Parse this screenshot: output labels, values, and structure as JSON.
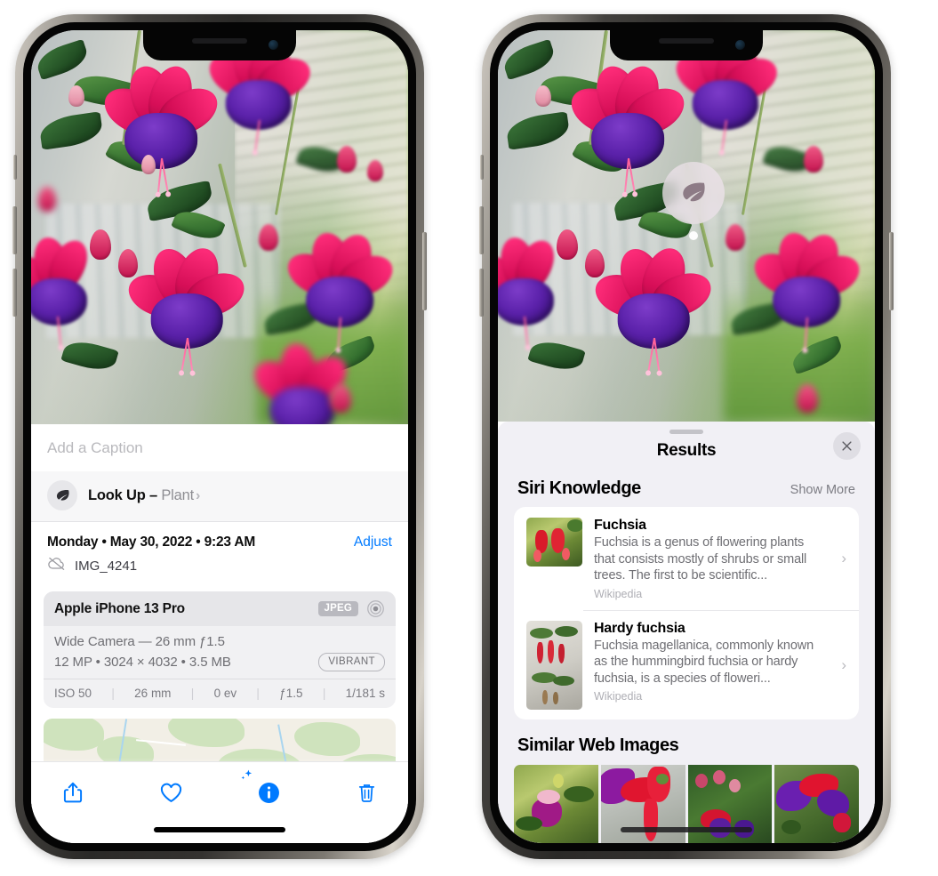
{
  "left_phone": {
    "name": "Photos app — photo info view",
    "photo_alt": "Fuchsia flowers with pink sepals and purple corollas",
    "caption_placeholder": "Add a Caption",
    "lookup": {
      "label": "Look Up –",
      "subject": "Plant",
      "chevron": "›",
      "icon": "leaf-icon",
      "sparkle_icon": "sparkle-icon"
    },
    "meta": {
      "date": "Monday • May 30, 2022 • 9:23 AM",
      "adjust_label": "Adjust",
      "cloud_icon": "cloud-slash-icon",
      "filename": "IMG_4241"
    },
    "exif": {
      "model": "Apple iPhone 13 Pro",
      "format_badge": "JPEG",
      "aperture_icon": "aperture-icon",
      "lens_line": "Wide Camera — 26 mm ƒ1.5",
      "size_line": "12 MP • 3024 × 4032 • 3.5 MB",
      "style_badge": "VIBRANT",
      "stats": [
        "ISO 50",
        "26 mm",
        "0 ev",
        "ƒ1.5",
        "1/181 s"
      ]
    },
    "map": {
      "pin_label": "photo-thumbnail-pin"
    },
    "toolbar": [
      {
        "name": "share-button",
        "icon": "share-icon"
      },
      {
        "name": "favorite-button",
        "icon": "heart-icon"
      },
      {
        "name": "info-button",
        "icon": "info-circle-icon"
      },
      {
        "name": "delete-button",
        "icon": "trash-icon"
      }
    ],
    "accent_color": "#007AFF"
  },
  "right_phone": {
    "name": "Visual Look Up results sheet",
    "photo_badge": {
      "icon": "leaf-icon",
      "name": "visual-lookup-badge"
    },
    "sheet": {
      "title": "Results",
      "close_icon": "close-icon",
      "grabber": "drag-handle"
    },
    "siri_knowledge": {
      "section_title": "Siri Knowledge",
      "show_more": "Show More",
      "items": [
        {
          "title": "Fuchsia",
          "description": "Fuchsia is a genus of flowering plants that consists mostly of shrubs or small trees. The first to be scientific...",
          "source": "Wikipedia",
          "chevron": "›",
          "thumb": "fuchsia-red-flowers-thumbnail"
        },
        {
          "title": "Hardy fuchsia",
          "description": "Fuchsia magellanica, commonly known as the hummingbird fuchsia or hardy fuchsia, is a species of floweri...",
          "source": "Wikipedia",
          "chevron": "›",
          "thumb": "hardy-fuchsia-specimen-thumbnail"
        }
      ]
    },
    "similar_web_images": {
      "section_title": "Similar Web Images",
      "thumbs": [
        "fuchsia-pink-white-bloom",
        "fuchsia-red-closeup",
        "fuchsia-bush-buds",
        "fuchsia-purple-red-cluster"
      ]
    }
  }
}
